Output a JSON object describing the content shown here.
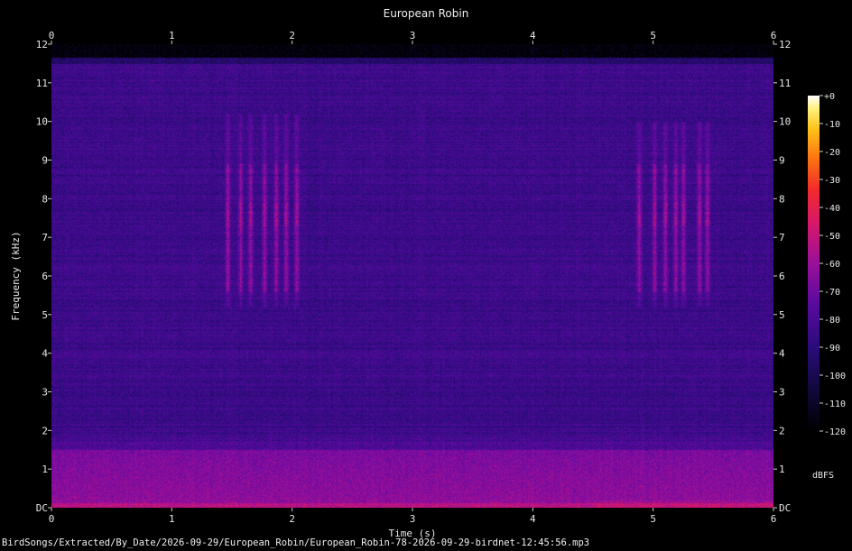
{
  "chart_data": {
    "type": "heatmap",
    "title": "European Robin",
    "xlabel": "Time (s)",
    "ylabel": "Frequency (kHz)",
    "xlim": [
      0,
      6
    ],
    "ylim": [
      0,
      12
    ],
    "x_ticks": [
      "0",
      "1",
      "2",
      "3",
      "4",
      "5",
      "6"
    ],
    "y_ticks": [
      "DC",
      "1",
      "2",
      "3",
      "4",
      "5",
      "6",
      "7",
      "8",
      "9",
      "10",
      "11",
      "12"
    ],
    "colorbar": {
      "label": "dBFS",
      "ticks": [
        "+0",
        "-10",
        "-20",
        "-30",
        "-40",
        "-50",
        "-60",
        "-70",
        "-80",
        "-90",
        "-100",
        "-110",
        "-120"
      ],
      "range": [
        -120,
        0
      ]
    },
    "colors": {
      "background": "#000000",
      "text": "#e8e8e8"
    },
    "song_bursts": [
      {
        "t_start": 1.4,
        "t_end": 2.1,
        "f_low": 5.2,
        "f_high": 10.2
      },
      {
        "t_start": 4.85,
        "t_end": 5.5,
        "f_low": 5.2,
        "f_high": 10.0
      }
    ]
  },
  "footer": {
    "path": "BirdSongs/Extracted/By_Date/2026-09-29/European_Robin/European_Robin-78-2026-09-29-birdnet-12:45:56.mp3"
  }
}
